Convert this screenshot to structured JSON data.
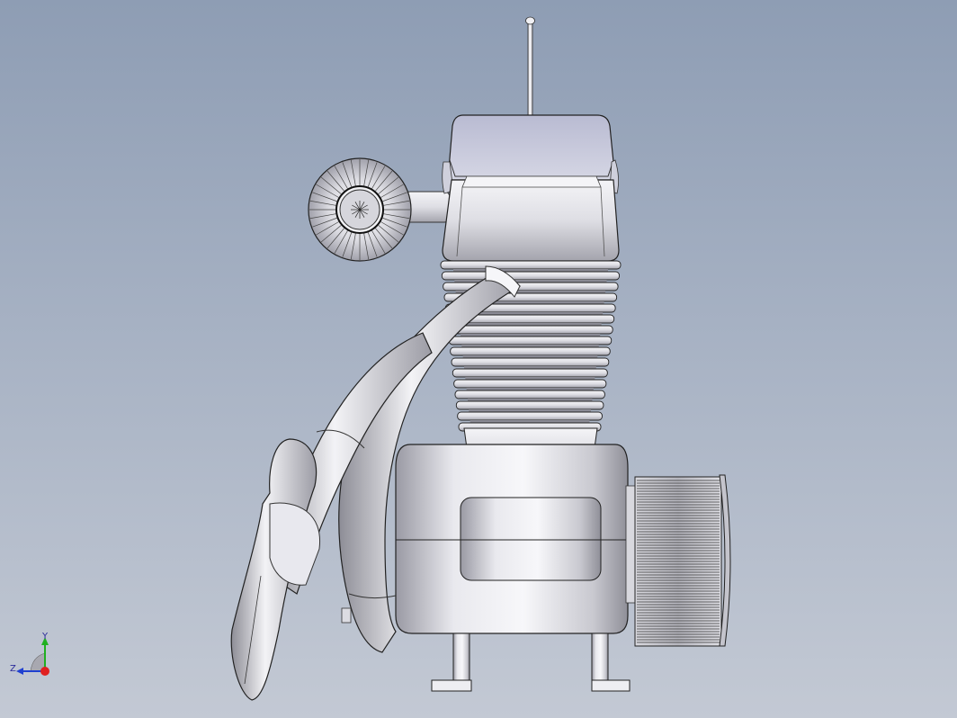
{
  "viewport": {
    "background_top": "#8e9db4",
    "background_bottom": "#c3c9d4",
    "model": "single-cylinder-engine"
  },
  "triad": {
    "y_label": "Y",
    "z_label": "Z",
    "x_color": "#e02020",
    "y_color": "#20b020",
    "z_color": "#2040d0"
  }
}
